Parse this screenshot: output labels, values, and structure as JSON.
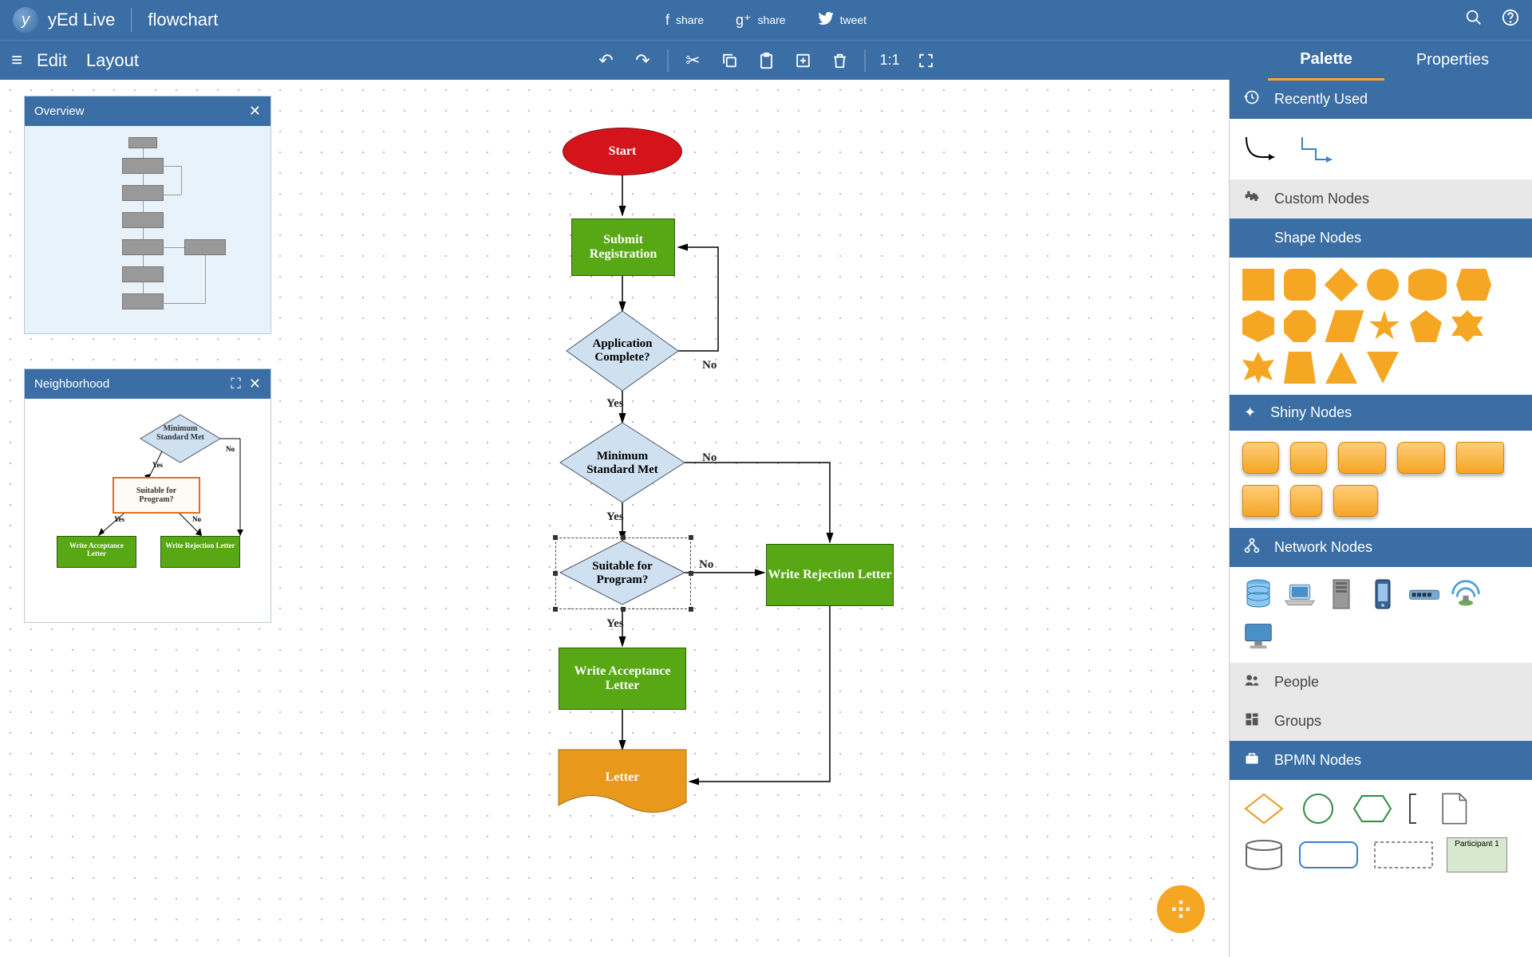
{
  "app": {
    "name": "yEd Live",
    "document": "flowchart"
  },
  "share": {
    "fb": "share",
    "gplus": "share",
    "tw": "tweet"
  },
  "menu": {
    "edit": "Edit",
    "layout": "Layout"
  },
  "toolbar": {
    "oneToOne": "1:1"
  },
  "tabs": {
    "palette": "Palette",
    "properties": "Properties",
    "active": "palette"
  },
  "panels": {
    "overview": {
      "title": "Overview"
    },
    "neighborhood": {
      "title": "Neighborhood",
      "minimum": "Minimum Standard Met",
      "suitable": "Suitable for Program?",
      "yes": "Yes",
      "no": "No",
      "acceptance": "Write Acceptance Letter",
      "rejection": "Write Rejection Letter"
    }
  },
  "flowchart": {
    "start": "Start",
    "submit": "Submit Registration",
    "appComplete": "Application Complete?",
    "minStd": "Minimum Standard Met",
    "suitable": "Suitable for Program?",
    "acceptance": "Write Acceptance Letter",
    "rejection": "Write Rejection Letter",
    "letter": "Letter",
    "yes": "Yes",
    "no": "No"
  },
  "palette": {
    "recently": "Recently Used",
    "custom": "Custom Nodes",
    "shape": "Shape Nodes",
    "shiny": "Shiny Nodes",
    "network": "Network Nodes",
    "people": "People",
    "groups": "Groups",
    "bpmn": "BPMN Nodes",
    "participant": "Participant 1"
  }
}
